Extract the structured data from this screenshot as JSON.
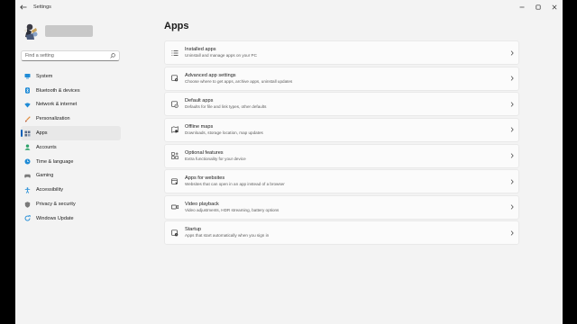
{
  "window": {
    "title": "Settings",
    "back_icon": "back-arrow-icon",
    "controls": [
      "minimize-icon",
      "maximize-icon",
      "close-icon"
    ]
  },
  "search": {
    "placeholder": "Find a setting"
  },
  "sidebar": {
    "items": [
      {
        "label": "System",
        "icon": "system-icon",
        "active": false,
        "color": "#1f8bd6"
      },
      {
        "label": "Bluetooth & devices",
        "icon": "bluetooth-icon",
        "active": false,
        "color": "#1f8bd6"
      },
      {
        "label": "Network & internet",
        "icon": "network-icon",
        "active": false,
        "color": "#1f8bd6"
      },
      {
        "label": "Personalization",
        "icon": "brush-icon",
        "active": false,
        "color": "#e08b3c"
      },
      {
        "label": "Apps",
        "icon": "apps-icon",
        "active": true,
        "color": "#5a6b85"
      },
      {
        "label": "Accounts",
        "icon": "accounts-icon",
        "active": false,
        "color": "#2fa36b"
      },
      {
        "label": "Time & language",
        "icon": "globe-clock-icon",
        "active": false,
        "color": "#1f8bd6"
      },
      {
        "label": "Gaming",
        "icon": "gamepad-icon",
        "active": false,
        "color": "#7a7a7a"
      },
      {
        "label": "Accessibility",
        "icon": "accessibility-icon",
        "active": false,
        "color": "#1f8bd6"
      },
      {
        "label": "Privacy & security",
        "icon": "shield-icon",
        "active": false,
        "color": "#7a7a7a"
      },
      {
        "label": "Windows Update",
        "icon": "update-icon",
        "active": false,
        "color": "#1f8bd6"
      }
    ]
  },
  "main": {
    "title": "Apps",
    "items": [
      {
        "title": "Installed apps",
        "subtitle": "Uninstall and manage apps on your PC",
        "icon": "list-icon"
      },
      {
        "title": "Advanced app settings",
        "subtitle": "Choose where to get apps, archive apps, uninstall updates",
        "icon": "app-gear-icon"
      },
      {
        "title": "Default apps",
        "subtitle": "Defaults for file and link types, other defaults",
        "icon": "default-apps-icon"
      },
      {
        "title": "Offline maps",
        "subtitle": "Downloads, storage location, map updates",
        "icon": "map-icon"
      },
      {
        "title": "Optional features",
        "subtitle": "Extra functionality for your device",
        "icon": "grid-plus-icon"
      },
      {
        "title": "Apps for websites",
        "subtitle": "Websites that can open in an app instead of a browser",
        "icon": "web-app-icon"
      },
      {
        "title": "Video playback",
        "subtitle": "Video adjustments, HDR streaming, battery options",
        "icon": "video-icon"
      },
      {
        "title": "Startup",
        "subtitle": "Apps that start automatically when you sign in",
        "icon": "startup-icon"
      }
    ]
  },
  "colors": {
    "accent": "#005fb8",
    "window_bg": "#f3f3f3",
    "card_bg": "#fbfbfb"
  }
}
